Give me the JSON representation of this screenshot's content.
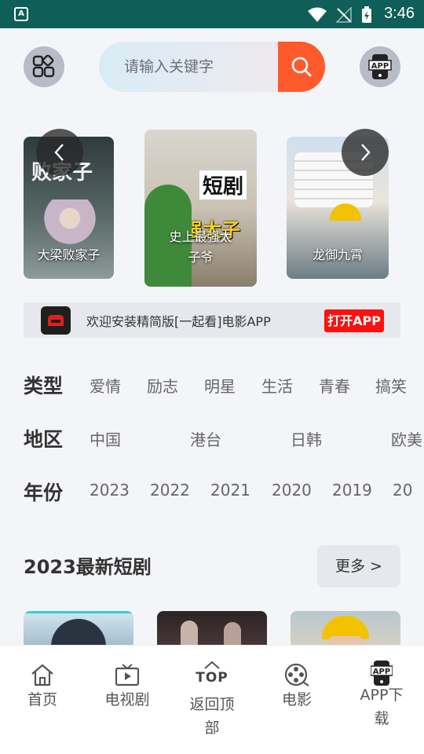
{
  "status_bar": {
    "time": "3:46"
  },
  "header": {
    "search_placeholder": "请输入关键字",
    "app_badge_text": "APP"
  },
  "carousel": {
    "posters": [
      {
        "title": "大梁败家子",
        "poster_text": "败家子"
      },
      {
        "title": "史上最强太子爷",
        "title_line1": "史上最强太",
        "title_line2": "子爷",
        "poster_text_1": "短剧",
        "poster_text_2": "上最强太子"
      },
      {
        "title": "龙御九霄"
      }
    ]
  },
  "banner": {
    "text": "欢迎安装精简版[一起看]电影APP",
    "button": "打开APP"
  },
  "filters": {
    "type": {
      "label": "类型",
      "options": [
        "爱情",
        "励志",
        "明星",
        "生活",
        "青春",
        "搞笑"
      ]
    },
    "region": {
      "label": "地区",
      "options": [
        "中国",
        "港台",
        "日韩",
        "欧美"
      ]
    },
    "year": {
      "label": "年份",
      "options": [
        "2023",
        "2022",
        "2021",
        "2020",
        "2019",
        "20"
      ]
    }
  },
  "section": {
    "title": "2023最新短剧",
    "more": "更多 >"
  },
  "tabbar": {
    "items": [
      {
        "label": "首页"
      },
      {
        "label": "电视剧"
      },
      {
        "label": "返回顶部",
        "line1": "返回顶",
        "line2": "部",
        "icon_text": "TOP"
      },
      {
        "label": "电影"
      },
      {
        "label": "APP下载",
        "line1": "APP下",
        "line2": "载",
        "icon_text": "APP"
      }
    ]
  },
  "colors": {
    "status_bar": "#0f5e57",
    "search_button": "#ff5a2c",
    "open_app": "#ff1010"
  }
}
